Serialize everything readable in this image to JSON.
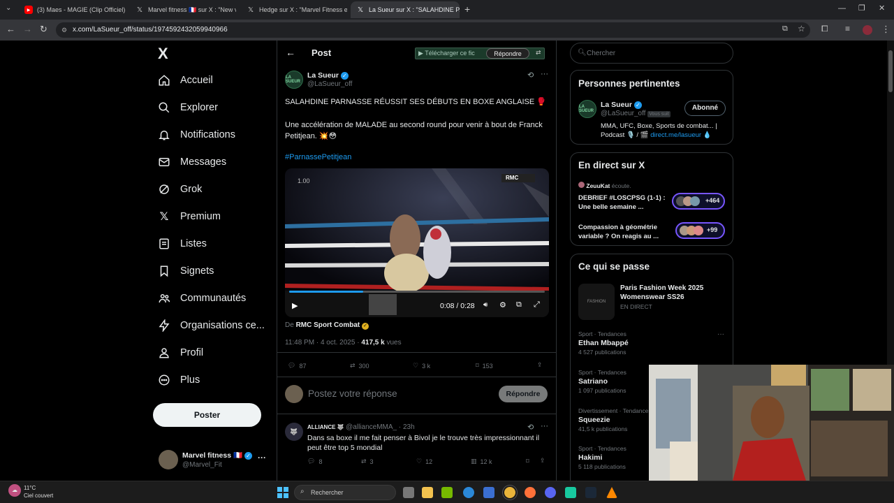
{
  "browser": {
    "tabs": [
      {
        "title": "(3) Maes - MAGIE (Clip Officiel)",
        "icon": "youtube-icon",
        "active": false
      },
      {
        "title": "Marvel fitness 🇫🇷 sur X : \"New v",
        "icon": "x-logo-icon",
        "active": false
      },
      {
        "title": "Hedge sur X : \"Marvel Fitness e",
        "icon": "x-logo-icon",
        "active": false
      },
      {
        "title": "La Sueur sur X : \"SALAHDINE PA",
        "icon": "x-logo-icon",
        "active": true
      }
    ],
    "new_tab": "+",
    "url": "x.com/LaSueur_off/status/1974592432059940966"
  },
  "sidebar": {
    "logo": "X",
    "items": [
      {
        "label": "Accueil",
        "icon": "home-icon"
      },
      {
        "label": "Explorer",
        "icon": "search-icon"
      },
      {
        "label": "Notifications",
        "icon": "bell-icon"
      },
      {
        "label": "Messages",
        "icon": "envelope-icon"
      },
      {
        "label": "Grok",
        "icon": "grok-icon"
      },
      {
        "label": "Premium",
        "icon": "x-premium-icon"
      },
      {
        "label": "Listes",
        "icon": "list-icon"
      },
      {
        "label": "Signets",
        "icon": "bookmark-icon"
      },
      {
        "label": "Communautés",
        "icon": "communities-icon"
      },
      {
        "label": "Organisations ce...",
        "icon": "lightning-icon"
      },
      {
        "label": "Profil",
        "icon": "person-icon"
      },
      {
        "label": "Plus",
        "icon": "more-circle-icon"
      }
    ],
    "post_button": "Poster",
    "account": {
      "name": "Marvel fitness 🇫🇷",
      "handle": "@Marvel_Fit",
      "more": "···"
    }
  },
  "main": {
    "header": {
      "back": "←",
      "title": "Post"
    },
    "overlay": {
      "download": "▶ Télécharger ce fic",
      "reply": "Répondre"
    },
    "tweet": {
      "author": "La Sueur",
      "handle": "@LaSueur_off",
      "avatar_text": "LA SUEUR",
      "line1": "SALAHDINE PARNASSE RÉUSSIT SES DÉBUTS EN BOXE ANGLAISE 🥊",
      "line2": "Une accélération de MALADE au second round pour venir à bout de Franck Petitjean. 💥😳",
      "hashtag": "#ParnassePetitjean",
      "video": {
        "speed": "1.00",
        "time": "0:08 / 0:28",
        "progress": 0.29,
        "channel": "RMC"
      },
      "from_prefix": "De",
      "from_name": "RMC Sport Combat",
      "timestamp": "11:48 PM · 4 oct. 2025 · ",
      "views_count": "417,5 k",
      "views_label": " vues",
      "replies": "87",
      "reposts": "300",
      "likes": "3 k",
      "bookmarks": "153"
    },
    "reply_box": {
      "placeholder": "Postez votre réponse",
      "button": "Répondre"
    },
    "reply": {
      "author": "ALLIANCE 🐺",
      "handle": "@allianceMMA_ · 23h",
      "text": "Dans sa boxe il me fait penser à Bivol je le trouve très impressionnant il peut être top 5 mondial",
      "replies": "8",
      "reposts": "3",
      "likes": "12",
      "views": "12 k"
    }
  },
  "right": {
    "search_placeholder": "Chercher",
    "relevant": {
      "title": "Personnes pertinentes",
      "name": "La Sueur",
      "handle": "@LaSueur_off",
      "follows_you": "Vous suit",
      "follow_button": "Abonné",
      "bio": "MMA, UFC, Boxe, Sports de combat... | Podcast 🎙️ / 🎬 ",
      "bio_link": "direct.me/lasueur 💧"
    },
    "live": {
      "title": "En direct sur X",
      "host": "ZeuuKat",
      "host_status": "écoute.",
      "items": [
        {
          "title": "DEBRIEF #LOSCPSG (1-1) : Une belle semaine ...",
          "count": "+464"
        },
        {
          "title": "Compassion à géométrie variable ? On reagis au ...",
          "count": "+99"
        }
      ]
    },
    "happening": {
      "title": "Ce qui se passe",
      "event": {
        "title": "Paris Fashion Week 2025 Womenswear SS26",
        "status": "EN DIRECT"
      },
      "trends": [
        {
          "category": "Sport · Tendances",
          "name": "Ethan Mbappé",
          "count": "4 527 publications"
        },
        {
          "category": "Sport · Tendances",
          "name": "Satriano",
          "count": "1 097 publications"
        },
        {
          "category": "Divertissement · Tendances",
          "name": "Squeezie",
          "count": "41,5 k publications"
        },
        {
          "category": "Sport · Tendances",
          "name": "Hakimi",
          "count": "5 118 publications"
        }
      ]
    }
  },
  "taskbar": {
    "weather_temp": "11°C",
    "weather_desc": "Ciel couvert",
    "search_placeholder": "Rechercher"
  }
}
